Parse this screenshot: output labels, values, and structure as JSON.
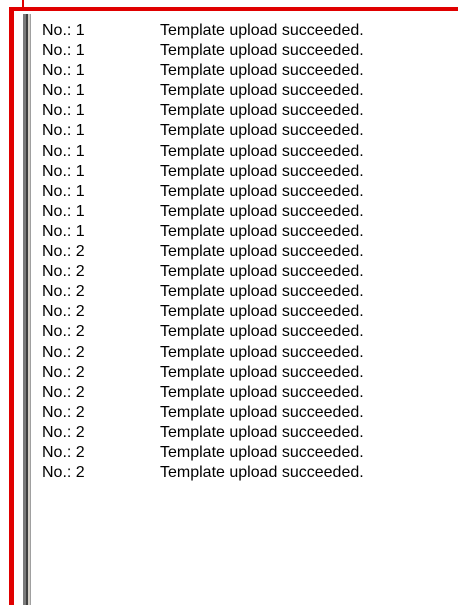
{
  "log": {
    "rows": [
      {
        "no": "No.: 1",
        "message": "Template upload succeeded."
      },
      {
        "no": "No.: 1",
        "message": "Template upload succeeded."
      },
      {
        "no": "No.: 1",
        "message": "Template upload succeeded."
      },
      {
        "no": "No.: 1",
        "message": "Template upload succeeded."
      },
      {
        "no": "No.: 1",
        "message": "Template upload succeeded."
      },
      {
        "no": "No.: 1",
        "message": "Template upload succeeded."
      },
      {
        "no": "No.: 1",
        "message": "Template upload succeeded."
      },
      {
        "no": "No.: 1",
        "message": "Template upload succeeded."
      },
      {
        "no": "No.: 1",
        "message": "Template upload succeeded."
      },
      {
        "no": "No.: 1",
        "message": "Template upload succeeded."
      },
      {
        "no": "No.: 1",
        "message": "Template upload succeeded."
      },
      {
        "no": "No.: 2",
        "message": "Template upload succeeded."
      },
      {
        "no": "No.: 2",
        "message": "Template upload succeeded."
      },
      {
        "no": "No.: 2",
        "message": "Template upload succeeded."
      },
      {
        "no": "No.: 2",
        "message": "Template upload succeeded."
      },
      {
        "no": "No.: 2",
        "message": "Template upload succeeded."
      },
      {
        "no": "No.: 2",
        "message": "Template upload succeeded."
      },
      {
        "no": "No.: 2",
        "message": "Template upload succeeded."
      },
      {
        "no": "No.: 2",
        "message": "Template upload succeeded."
      },
      {
        "no": "No.: 2",
        "message": "Template upload succeeded."
      },
      {
        "no": "No.: 2",
        "message": "Template upload succeeded."
      },
      {
        "no": "No.: 2",
        "message": "Template upload succeeded."
      },
      {
        "no": "No.: 2",
        "message": "Template upload succeeded."
      }
    ]
  },
  "colors": {
    "annotation": "#e00000",
    "list_background": "#ffffff",
    "text": "#000000"
  }
}
